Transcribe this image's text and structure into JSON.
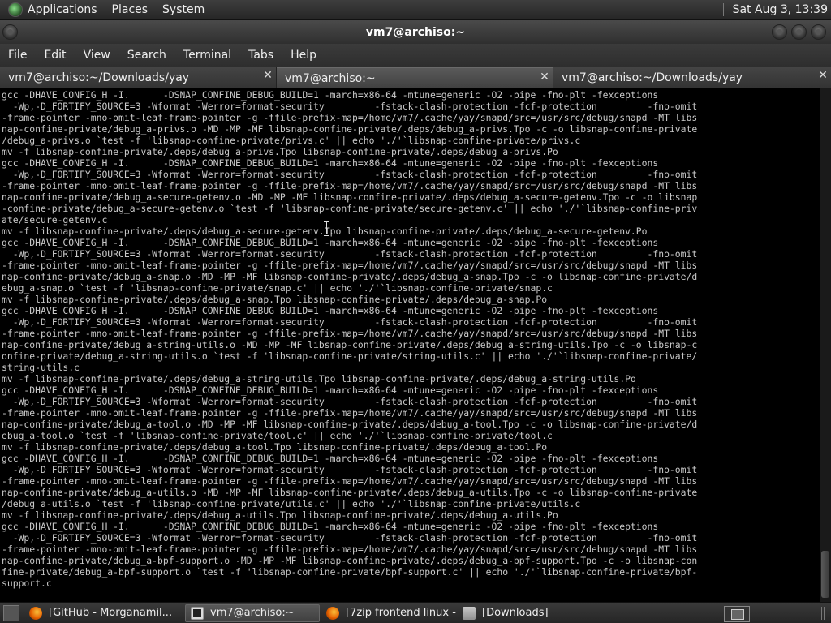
{
  "top_panel": {
    "menus": [
      "Applications",
      "Places",
      "System"
    ],
    "clock": "Sat Aug  3, 13:39"
  },
  "window": {
    "title": "vm7@archiso:~"
  },
  "menubar": [
    "File",
    "Edit",
    "View",
    "Search",
    "Terminal",
    "Tabs",
    "Help"
  ],
  "tabs": [
    {
      "label": "vm7@archiso:~/Downloads/yay",
      "active": false
    },
    {
      "label": "vm7@archiso:~",
      "active": true
    },
    {
      "label": "vm7@archiso:~/Downloads/yay",
      "active": false
    }
  ],
  "terminal_lines": [
    "gcc -DHAVE_CONFIG_H -I.      -DSNAP_CONFINE_DEBUG_BUILD=1 -march=x86-64 -mtune=generic -O2 -pipe -fno-plt -fexceptions",
    "  -Wp,-D_FORTIFY_SOURCE=3 -Wformat -Werror=format-security         -fstack-clash-protection -fcf-protection         -fno-omit",
    "-frame-pointer -mno-omit-leaf-frame-pointer -g -ffile-prefix-map=/home/vm7/.cache/yay/snapd/src=/usr/src/debug/snapd -MT libs",
    "nap-confine-private/debug_a-privs.o -MD -MP -MF libsnap-confine-private/.deps/debug_a-privs.Tpo -c -o libsnap-confine-private",
    "/debug_a-privs.o `test -f 'libsnap-confine-private/privs.c' || echo './'`libsnap-confine-private/privs.c",
    "mv -f libsnap-confine-private/.deps/debug_a-privs.Tpo libsnap-confine-private/.deps/debug_a-privs.Po",
    "gcc -DHAVE_CONFIG_H -I.      -DSNAP_CONFINE_DEBUG_BUILD=1 -march=x86-64 -mtune=generic -O2 -pipe -fno-plt -fexceptions",
    "  -Wp,-D_FORTIFY_SOURCE=3 -Wformat -Werror=format-security         -fstack-clash-protection -fcf-protection         -fno-omit",
    "-frame-pointer -mno-omit-leaf-frame-pointer -g -ffile-prefix-map=/home/vm7/.cache/yay/snapd/src=/usr/src/debug/snapd -MT libs",
    "nap-confine-private/debug_a-secure-getenv.o -MD -MP -MF libsnap-confine-private/.deps/debug_a-secure-getenv.Tpo -c -o libsnap",
    "-confine-private/debug_a-secure-getenv.o `test -f 'libsnap-confine-private/secure-getenv.c' || echo './'`libsnap-confine-priv",
    "ate/secure-getenv.c",
    "mv -f libsnap-confine-private/.deps/debug_a-secure-getenv.Tpo libsnap-confine-private/.deps/debug_a-secure-getenv.Po",
    "gcc -DHAVE_CONFIG_H -I.      -DSNAP_CONFINE_DEBUG_BUILD=1 -march=x86-64 -mtune=generic -O2 -pipe -fno-plt -fexceptions",
    "  -Wp,-D_FORTIFY_SOURCE=3 -Wformat -Werror=format-security         -fstack-clash-protection -fcf-protection         -fno-omit",
    "-frame-pointer -mno-omit-leaf-frame-pointer -g -ffile-prefix-map=/home/vm7/.cache/yay/snapd/src=/usr/src/debug/snapd -MT libs",
    "nap-confine-private/debug_a-snap.o -MD -MP -MF libsnap-confine-private/.deps/debug_a-snap.Tpo -c -o libsnap-confine-private/d",
    "ebug_a-snap.o `test -f 'libsnap-confine-private/snap.c' || echo './'`libsnap-confine-private/snap.c",
    "mv -f libsnap-confine-private/.deps/debug_a-snap.Tpo libsnap-confine-private/.deps/debug_a-snap.Po",
    "gcc -DHAVE_CONFIG_H -I.      -DSNAP_CONFINE_DEBUG_BUILD=1 -march=x86-64 -mtune=generic -O2 -pipe -fno-plt -fexceptions",
    "  -Wp,-D_FORTIFY_SOURCE=3 -Wformat -Werror=format-security         -fstack-clash-protection -fcf-protection         -fno-omit",
    "-frame-pointer -mno-omit-leaf-frame-pointer -g -ffile-prefix-map=/home/vm7/.cache/yay/snapd/src=/usr/src/debug/snapd -MT libs",
    "nap-confine-private/debug_a-string-utils.o -MD -MP -MF libsnap-confine-private/.deps/debug_a-string-utils.Tpo -c -o libsnap-c",
    "onfine-private/debug_a-string-utils.o `test -f 'libsnap-confine-private/string-utils.c' || echo './'`libsnap-confine-private/",
    "string-utils.c",
    "mv -f libsnap-confine-private/.deps/debug_a-string-utils.Tpo libsnap-confine-private/.deps/debug_a-string-utils.Po",
    "gcc -DHAVE_CONFIG_H -I.      -DSNAP_CONFINE_DEBUG_BUILD=1 -march=x86-64 -mtune=generic -O2 -pipe -fno-plt -fexceptions",
    "  -Wp,-D_FORTIFY_SOURCE=3 -Wformat -Werror=format-security         -fstack-clash-protection -fcf-protection         -fno-omit",
    "-frame-pointer -mno-omit-leaf-frame-pointer -g -ffile-prefix-map=/home/vm7/.cache/yay/snapd/src=/usr/src/debug/snapd -MT libs",
    "nap-confine-private/debug_a-tool.o -MD -MP -MF libsnap-confine-private/.deps/debug_a-tool.Tpo -c -o libsnap-confine-private/d",
    "ebug_a-tool.o `test -f 'libsnap-confine-private/tool.c' || echo './'`libsnap-confine-private/tool.c",
    "mv -f libsnap-confine-private/.deps/debug_a-tool.Tpo libsnap-confine-private/.deps/debug_a-tool.Po",
    "gcc -DHAVE_CONFIG_H -I.      -DSNAP_CONFINE_DEBUG_BUILD=1 -march=x86-64 -mtune=generic -O2 -pipe -fno-plt -fexceptions",
    "  -Wp,-D_FORTIFY_SOURCE=3 -Wformat -Werror=format-security         -fstack-clash-protection -fcf-protection         -fno-omit",
    "-frame-pointer -mno-omit-leaf-frame-pointer -g -ffile-prefix-map=/home/vm7/.cache/yay/snapd/src=/usr/src/debug/snapd -MT libs",
    "nap-confine-private/debug_a-utils.o -MD -MP -MF libsnap-confine-private/.deps/debug_a-utils.Tpo -c -o libsnap-confine-private",
    "/debug_a-utils.o `test -f 'libsnap-confine-private/utils.c' || echo './'`libsnap-confine-private/utils.c",
    "mv -f libsnap-confine-private/.deps/debug_a-utils.Tpo libsnap-confine-private/.deps/debug_a-utils.Po",
    "gcc -DHAVE_CONFIG_H -I.      -DSNAP_CONFINE_DEBUG_BUILD=1 -march=x86-64 -mtune=generic -O2 -pipe -fno-plt -fexceptions",
    "  -Wp,-D_FORTIFY_SOURCE=3 -Wformat -Werror=format-security         -fstack-clash-protection -fcf-protection         -fno-omit",
    "-frame-pointer -mno-omit-leaf-frame-pointer -g -ffile-prefix-map=/home/vm7/.cache/yay/snapd/src=/usr/src/debug/snapd -MT libs",
    "nap-confine-private/debug_a-bpf-support.o -MD -MP -MF libsnap-confine-private/.deps/debug_a-bpf-support.Tpo -c -o libsnap-con",
    "fine-private/debug_a-bpf-support.o `test -f 'libsnap-confine-private/bpf-support.c' || echo './'`libsnap-confine-private/bpf-",
    "support.c"
  ],
  "taskbar": {
    "tasks": [
      {
        "label": "[GitHub - Morganamil...",
        "icon": "firefox-icon",
        "active": false
      },
      {
        "label": "vm7@archiso:~",
        "icon": "terminal-icon",
        "active": true
      },
      {
        "label": "[7zip frontend linux - ...",
        "icon": "firefox-icon",
        "active": false
      },
      {
        "label": "[Downloads]",
        "icon": "folder-icon",
        "active": false
      }
    ]
  }
}
